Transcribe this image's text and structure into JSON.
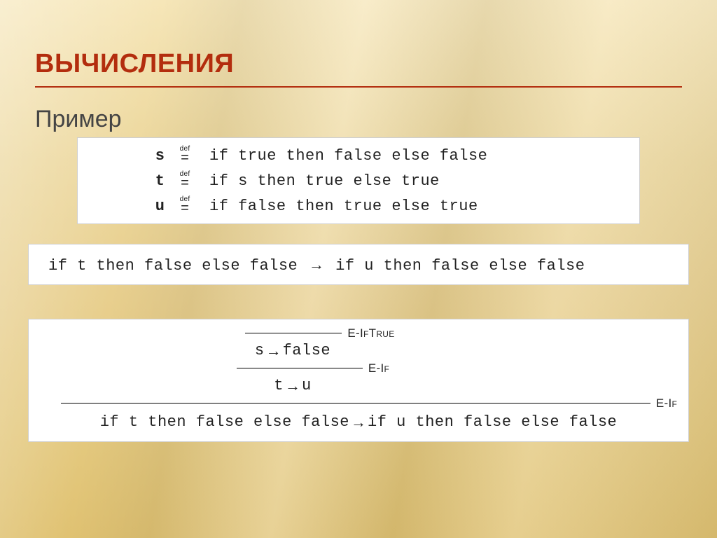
{
  "title": "ВЫЧИСЛЕНИЯ",
  "subtitle": "Пример",
  "defs": [
    {
      "var": "s",
      "body": "if true then false else false"
    },
    {
      "var": "t",
      "body": "if s then true else true"
    },
    {
      "var": "u",
      "body": "if false then true else true"
    }
  ],
  "def_label": "def",
  "step": {
    "lhs": "if t then false else false",
    "rhs": "if u then false else false"
  },
  "derivation": {
    "rule_iftrue": "E-IfTrue",
    "rule_if": "E-If",
    "s_to_false": {
      "lhs": "s",
      "rhs": "false"
    },
    "t_to_u": {
      "lhs": "t",
      "rhs": "u"
    },
    "conclusion": {
      "lhs": "if t then false else false",
      "rhs": "if u then false else false"
    }
  },
  "arrow": "→"
}
